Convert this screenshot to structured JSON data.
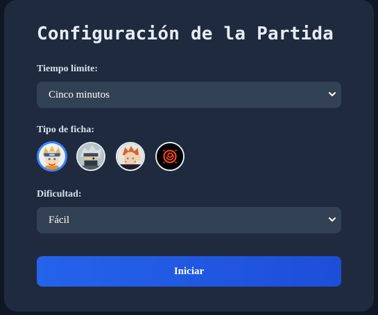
{
  "title": "Configuración de la Partida",
  "time_limit": {
    "label": "Tiempo límite:",
    "selected": "Cinco minutos"
  },
  "token_type": {
    "label": "Tipo de ficha:",
    "options": [
      {
        "icon": "naruto-avatar-icon",
        "selected": true
      },
      {
        "icon": "kakashi-avatar-icon",
        "selected": false
      },
      {
        "icon": "pain-avatar-icon",
        "selected": false
      },
      {
        "icon": "spiral-symbol-icon",
        "selected": false
      }
    ]
  },
  "difficulty": {
    "label": "Dificultad:",
    "selected": "Fácil"
  },
  "start_button": "Iniciar",
  "colors": {
    "background": "#0f1726",
    "card": "#1f2a3e",
    "select": "#334155",
    "accent": "#2563eb",
    "selected_ring": "#3b82f6"
  }
}
